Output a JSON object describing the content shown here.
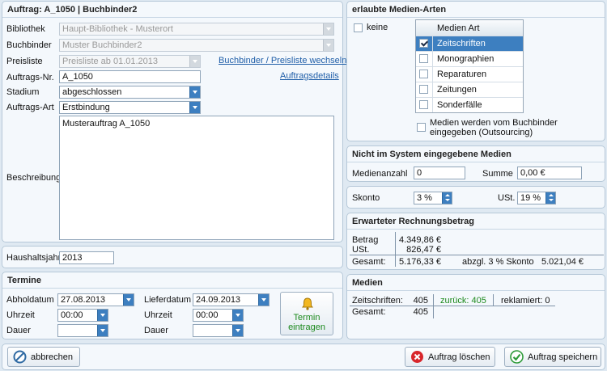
{
  "auftrag": {
    "title": "Auftrag: A_1050 | Buchbinder2",
    "bibliothek_label": "Bibliothek",
    "bibliothek_value": "Haupt-Bibliothek - Musterort",
    "buchbinder_label": "Buchbinder",
    "buchbinder_value": "Muster Buchbinder2",
    "preisliste_label": "Preisliste",
    "preisliste_value": "Preisliste ab 01.01.2013",
    "wechseln_link": "Buchbinder / Preisliste wechseln",
    "auftragsnr_label": "Auftrags-Nr.",
    "auftragsnr_value": "A_1050",
    "details_link": "Auftragsdetails",
    "stadium_label": "Stadium",
    "stadium_value": "abgeschlossen",
    "art_label": "Auftrags-Art",
    "art_value": "Erstbindung",
    "beschreibung_label": "Beschreibung",
    "beschreibung_value": "Musterauftrag A_1050"
  },
  "haushalt": {
    "label": "Haushaltsjahr",
    "value": "2013"
  },
  "termine": {
    "title": "Termine",
    "abholdatum_label": "Abholdatum",
    "abholdatum_value": "27.08.2013",
    "uhrzeit1_label": "Uhrzeit",
    "uhrzeit1_value": "00:00",
    "dauer1_label": "Dauer",
    "dauer1_value": "",
    "lieferdatum_label": "Lieferdatum",
    "lieferdatum_value": "24.09.2013",
    "uhrzeit2_label": "Uhrzeit",
    "uhrzeit2_value": "00:00",
    "dauer2_label": "Dauer",
    "dauer2_value": "",
    "termin_button_line1": "Termin",
    "termin_button_line2": "eintragen"
  },
  "medienarten": {
    "title": "erlaubte Medien-Arten",
    "keine_label": "keine",
    "header": "Medien Art",
    "items": [
      {
        "label": "Zeitschriften",
        "checked": true,
        "selected": true
      },
      {
        "label": "Monographien",
        "checked": false,
        "selected": false
      },
      {
        "label": "Reparaturen",
        "checked": false,
        "selected": false
      },
      {
        "label": "Zeitungen",
        "checked": false,
        "selected": false
      },
      {
        "label": "Sonderfälle",
        "checked": false,
        "selected": false
      }
    ],
    "outsourcing_line1": "Medien werden vom Buchbinder",
    "outsourcing_line2": "eingegeben (Outsourcing)"
  },
  "nicht_im_system": {
    "title": "Nicht im System eingegebene Medien",
    "anzahl_label": "Medienanzahl",
    "anzahl_value": "0",
    "summe_label": "Summe",
    "summe_value": "0,00 €"
  },
  "skonto": {
    "skonto_label": "Skonto",
    "skonto_value": "3 %",
    "ust_label": "USt.",
    "ust_value": "19 %"
  },
  "rechnung": {
    "title": "Erwarteter Rechnungsbetrag",
    "betrag_label": "Betrag",
    "betrag_value": "4.349,86 €",
    "ust_label": "USt.",
    "ust_value": "826,47 €",
    "gesamt_label": "Gesamt:",
    "gesamt_value": "5.176,33 €",
    "abzgl_label": "abzgl. 3 % Skonto",
    "abzgl_value": "5.021,04 €"
  },
  "medien": {
    "title": "Medien",
    "zeitschriften_label": "Zeitschriften:",
    "zeitschriften_value": "405",
    "zurueck_label": "zurück: 405",
    "reklamiert_label": "reklamiert: 0",
    "gesamt_label": "Gesamt:",
    "gesamt_value": "405"
  },
  "footer": {
    "abbrechen": "abbrechen",
    "loeschen": "Auftrag löschen",
    "speichern": "Auftrag speichern"
  },
  "colors": {
    "accent": "#3d7fc0",
    "link": "#1f5ea8",
    "green_text": "#1d8a1d",
    "delete_red": "#d8262b",
    "save_green": "#2f9b3a"
  }
}
